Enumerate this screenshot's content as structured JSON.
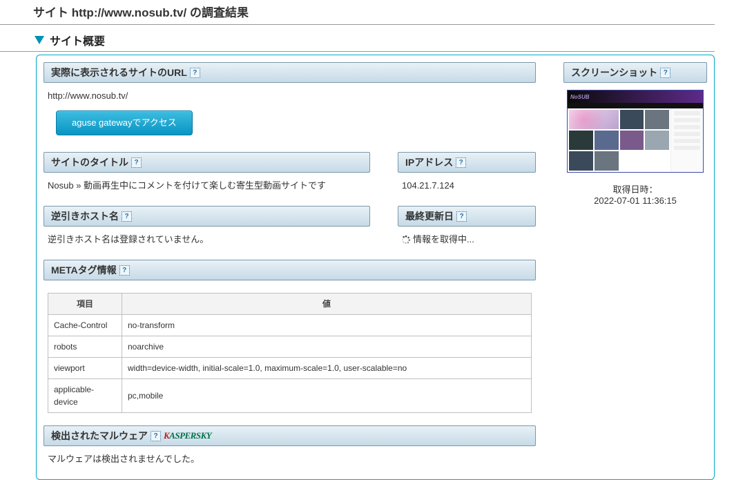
{
  "page": {
    "heading": "サイト http://www.nosub.tv/ の調査結果",
    "section_title": "サイト概要"
  },
  "url_panel": {
    "title": "実際に表示されるサイトのURL",
    "url": "http://www.nosub.tv/",
    "button_label": "aguse gatewayでアクセス"
  },
  "site_title_panel": {
    "title": "サイトのタイトル",
    "value": "Nosub » 動画再生中にコメントを付けて楽しむ寄生型動画サイトです"
  },
  "ip_panel": {
    "title": "IPアドレス",
    "value": "104.21.7.124"
  },
  "rev_host_panel": {
    "title": "逆引きホスト名",
    "value": "逆引きホスト名は登録されていません。"
  },
  "last_update_panel": {
    "title": "最終更新日",
    "value": "情報を取得中..."
  },
  "meta_panel": {
    "title": "METAタグ情報",
    "headers": {
      "item": "項目",
      "value": "値"
    },
    "rows": [
      {
        "k": "Cache-Control",
        "v": "no-transform"
      },
      {
        "k": "robots",
        "v": "noarchive"
      },
      {
        "k": "viewport",
        "v": "width=device-width, initial-scale=1.0, maximum-scale=1.0, user-scalable=no"
      },
      {
        "k": "applicable-device",
        "v": "pc,mobile"
      }
    ]
  },
  "malware_panel": {
    "title": "検出されたマルウェア",
    "logo": {
      "k": "K",
      "rest": "ASPERSKY"
    },
    "value": "マルウェアは検出されませんでした。"
  },
  "screenshot_panel": {
    "title": "スクリーンショット",
    "ts_label": "取得日時：",
    "ts_value": "2022-07-01 11:36:15"
  },
  "icons": {
    "help": "?"
  }
}
